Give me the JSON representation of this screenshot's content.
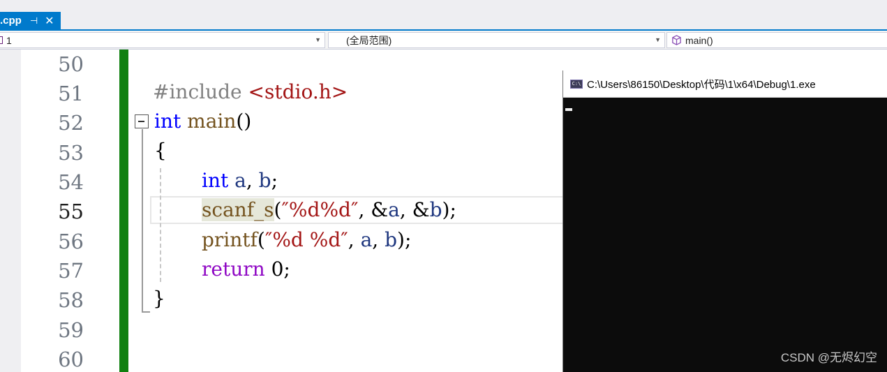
{
  "tab": {
    "name": ".cpp",
    "pin_glyph": "⊣",
    "close_glyph": "✕"
  },
  "navbar": {
    "project": "1",
    "scope": "(全局范围)",
    "member": "main()"
  },
  "editor": {
    "line_numbers": [
      "50",
      "51",
      "52",
      "53",
      "54",
      "55",
      "56",
      "57",
      "58",
      "59",
      "60"
    ],
    "current_line": "55",
    "code": {
      "l51_pp": "#include",
      "l51_hdr": "<stdio.h>",
      "l52_kw": "int",
      "l52_fn": "main",
      "l52_p": "()",
      "l53": "{",
      "l54_kw": "int",
      "l54_a": "a",
      "l54_c": ", ",
      "l54_b": "b",
      "l54_s": ";",
      "l55_fn": "scanf_s",
      "l55_o": "(",
      "l55_str": "″%d%d″",
      "l55_c1": ", &",
      "l55_a": "a",
      "l55_c2": ", &",
      "l55_b": "b",
      "l55_e": ");",
      "l56_fn": "printf",
      "l56_o": "(",
      "l56_str": "″%d %d″",
      "l56_c1": ", ",
      "l56_a": "a",
      "l56_c2": ", ",
      "l56_b": "b",
      "l56_e": ");",
      "l57_kw": "return",
      "l57_num": "0",
      "l57_e": ";",
      "l58": "}"
    }
  },
  "console": {
    "title": "C:\\Users\\86150\\Desktop\\代码\\1\\x64\\Debug\\1.exe",
    "icon_text": "C:\\"
  },
  "watermark": "CSDN @无烬幻空",
  "colors": {
    "accent": "#007acc",
    "change_bar": "#108010",
    "console_bg": "#0c0c0c"
  }
}
